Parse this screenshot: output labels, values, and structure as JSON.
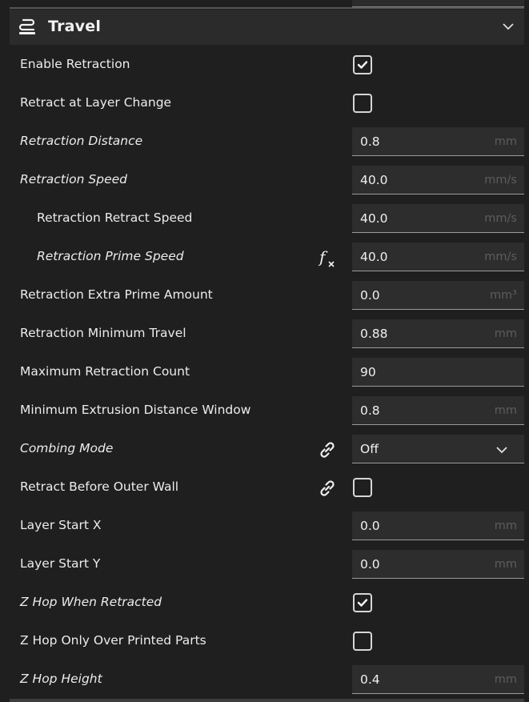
{
  "section": {
    "title": "Travel",
    "icon": "travel-icon",
    "collapse_icon": "chevron-down-icon"
  },
  "colors": {
    "background": "#1f1f1f",
    "header": "#2b2b2b",
    "field": "#2d2d2d",
    "text": "#ececec",
    "unit": "#5d5d5d"
  },
  "settings": [
    {
      "label": "Enable Retraction",
      "type": "checkbox",
      "checked": true
    },
    {
      "label": "Retract at Layer Change",
      "type": "checkbox",
      "checked": false
    },
    {
      "label": "Retraction Distance",
      "type": "number",
      "value": "0.8",
      "unit": "mm",
      "italic": true
    },
    {
      "label": "Retraction Speed",
      "type": "number",
      "value": "40.0",
      "unit": "mm/s",
      "italic": true
    },
    {
      "label": "Retraction Retract Speed",
      "type": "number",
      "value": "40.0",
      "unit": "mm/s",
      "indent": true
    },
    {
      "label": "Retraction Prime Speed",
      "type": "number",
      "value": "40.0",
      "unit": "mm/s",
      "indent": true,
      "italic": true,
      "icon": "function-icon"
    },
    {
      "label": "Retraction Extra Prime Amount",
      "type": "number",
      "value": "0.0",
      "unit": "mm³"
    },
    {
      "label": "Retraction Minimum Travel",
      "type": "number",
      "value": "0.88",
      "unit": "mm"
    },
    {
      "label": "Maximum Retraction Count",
      "type": "number",
      "value": "90",
      "unit": ""
    },
    {
      "label": "Minimum Extrusion Distance Window",
      "type": "number",
      "value": "0.8",
      "unit": "mm"
    },
    {
      "label": "Combing Mode",
      "type": "select",
      "value": "Off",
      "italic": true,
      "icon": "link-icon"
    },
    {
      "label": "Retract Before Outer Wall",
      "type": "checkbox",
      "checked": false,
      "icon": "link-icon"
    },
    {
      "label": "Layer Start X",
      "type": "number",
      "value": "0.0",
      "unit": "mm"
    },
    {
      "label": "Layer Start Y",
      "type": "number",
      "value": "0.0",
      "unit": "mm"
    },
    {
      "label": "Z Hop When Retracted",
      "type": "checkbox",
      "checked": true,
      "italic": true
    },
    {
      "label": "Z Hop Only Over Printed Parts",
      "type": "checkbox",
      "checked": false
    },
    {
      "label": "Z Hop Height",
      "type": "number",
      "value": "0.4",
      "unit": "mm",
      "italic": true
    }
  ]
}
